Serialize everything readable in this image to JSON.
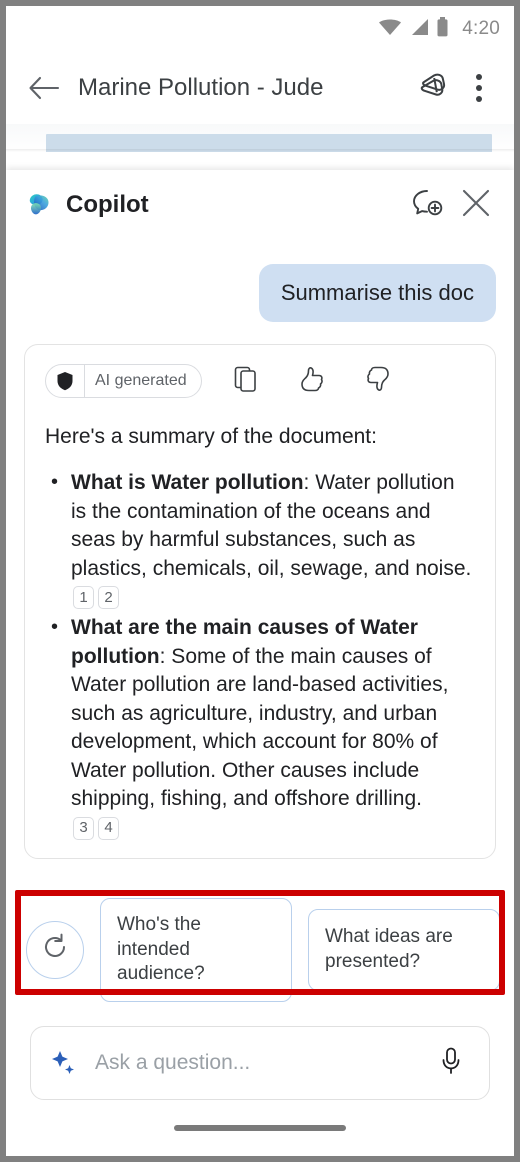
{
  "status_bar": {
    "time": "4:20",
    "icons": [
      "wifi-icon",
      "cellular-signal-icon",
      "battery-icon"
    ]
  },
  "app_bar": {
    "back_icon": "back-arrow-icon",
    "title": "Marine Pollution - Jude",
    "cast_icon": "cast-icon",
    "overflow_icon": "more-vertical-icon"
  },
  "copilot": {
    "logo_icon": "copilot-logo-icon",
    "title": "Copilot",
    "new_chat_icon": "new-chat-icon",
    "close_icon": "close-icon"
  },
  "conversation": {
    "user_message": "Summarise this doc",
    "response_card": {
      "ai_badge": {
        "shield_icon": "shield-icon",
        "label": "AI generated"
      },
      "actions": [
        {
          "name": "copy-icon",
          "label": "Copy"
        },
        {
          "name": "thumbs-up-icon",
          "label": "Like"
        },
        {
          "name": "thumbs-down-icon",
          "label": "Dislike"
        }
      ],
      "lead": "Here's a summary of the document:",
      "bullets": [
        {
          "heading": "What is Water pollution",
          "body": ": Water pollution is the contamination of the oceans and seas by harmful substances, such as plastics, chemicals, oil, sewage, and noise.",
          "citations": [
            "1",
            "2"
          ]
        },
        {
          "heading": "What are the main causes of Water pollution",
          "body": ": Some of the main causes of Water pollution are land-based activities, such as agriculture, industry, and urban development, which account for 80% of Water pollution. Other causes include shipping, fishing, and offshore drilling.",
          "citations": [
            "3",
            "4"
          ]
        }
      ]
    }
  },
  "suggestions": {
    "refresh_icon": "refresh-icon",
    "chips": [
      {
        "label": "Who's the intended audience?"
      },
      {
        "label": "What ideas are presented?"
      },
      {
        "label": ""
      }
    ],
    "highlight_color": "#cc0000"
  },
  "composer": {
    "sparkle_icon": "sparkle-icon",
    "placeholder": "Ask a question...",
    "value": "",
    "mic_icon": "microphone-icon"
  },
  "system_nav": {
    "home_indicator": "home-indicator"
  },
  "colors": {
    "user_bubble": "#cfdff2",
    "chip_border": "#b9d0ec",
    "accent_blue": "#2b5fb8",
    "highlight_red": "#cc0000"
  }
}
